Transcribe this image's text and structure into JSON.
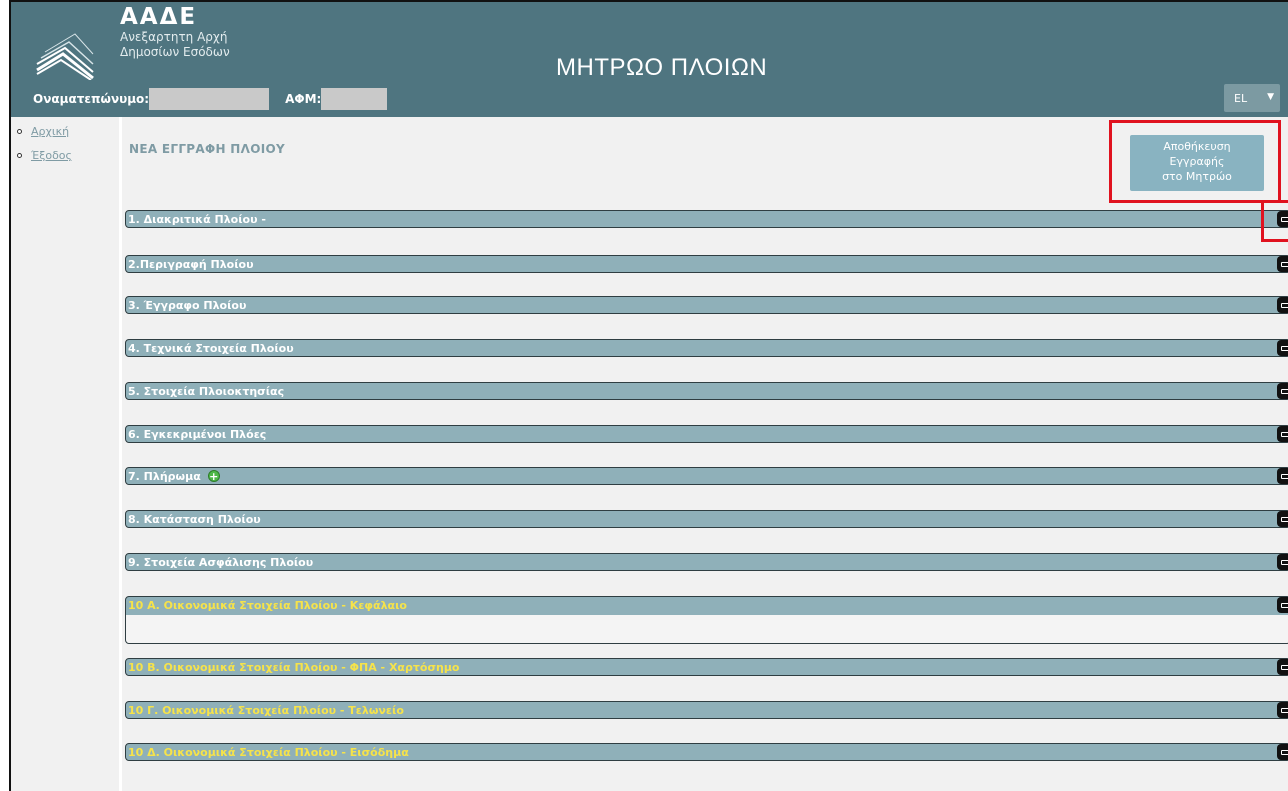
{
  "header": {
    "brand_name": "ΑΑΔΕ",
    "brand_line1": "Ανεξαρτητη Αρχή",
    "brand_line2": "Δημοσίων Εσόδων",
    "app_title": "ΜΗΤΡΩΟ ΠΛΟΙΩΝ",
    "name_label": "Οναματεπώνυμο:",
    "afm_label": "ΑΦΜ:",
    "language": "EL"
  },
  "sidebar": {
    "items": [
      {
        "label": "Αρχική"
      },
      {
        "label": "Έξοδος"
      }
    ]
  },
  "main": {
    "page_title": "ΝΕΑ ΕΓΓΡΑΦΗ ΠΛΟΙΟΥ",
    "save_button": {
      "line1": "Αποθήκευση",
      "line2": "Εγγραφής",
      "line3": "στο Μητρώο"
    },
    "sections": [
      {
        "label": "1. Διακριτικά Πλοίου -"
      },
      {
        "label": "2.Περιγραφή Πλοίου"
      },
      {
        "label": "3. Έγγραφο Πλοίου"
      },
      {
        "label": "4. Τεχνικά Στοιχεία Πλοίου"
      },
      {
        "label": "5. Στοιχεία Πλοιοκτησίας"
      },
      {
        "label": "6. Εγκεκριμένοι Πλόες"
      },
      {
        "label": "7. Πλήρωμα"
      },
      {
        "label": "8. Κατάσταση Πλοίου"
      },
      {
        "label": "9. Στοιχεία Ασφάλισης Πλοίου"
      },
      {
        "label": "10 Α. Οικονομικά Στοιχεία Πλοίου - Κεφάλαιο"
      },
      {
        "label": "10 Β. Οικονομικά Στοιχεία Πλοίου - ΦΠΑ - Χαρτόσημο"
      },
      {
        "label": "10 Γ. Οικονομικά Στοιχεία Πλοίου - Τελωνείο"
      },
      {
        "label": "10 Δ. Οικονομικά Στοιχεία Πλοίου - Εισόδημα"
      }
    ]
  },
  "colors": {
    "header_bg": "#4f7580",
    "section_bg": "#8fb0b9",
    "financial_text": "#f6e34a",
    "highlight_red": "#e0121f"
  }
}
